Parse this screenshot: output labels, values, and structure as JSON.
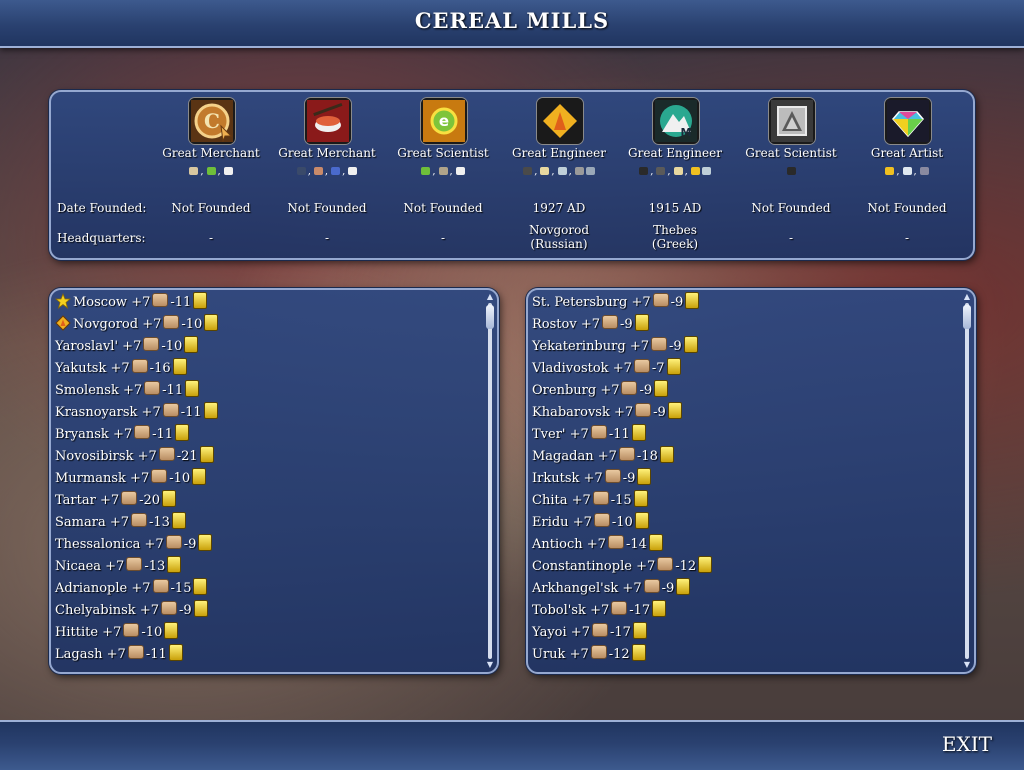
{
  "title": "CEREAL MILLS",
  "exit_label": "EXIT",
  "row_labels": {
    "date_founded": "Date Founded:",
    "headquarters": "Headquarters:"
  },
  "corporations": [
    {
      "icon": "cereal-mills-icon",
      "name": "Great Merchant",
      "resources": [
        {
          "c": "#d8c7a0",
          "sep": ","
        },
        {
          "c": "#6fbf3a",
          "sep": ","
        },
        {
          "c": "#f0f0f0",
          "sep": ""
        }
      ],
      "date": "Not Founded",
      "hq_line1": "-",
      "hq_line2": ""
    },
    {
      "icon": "sid-sushi-icon",
      "name": "Great Merchant",
      "resources": [
        {
          "c": "#3a4a6a",
          "sep": ","
        },
        {
          "c": "#c98a6a",
          "sep": ","
        },
        {
          "c": "#4a6acc",
          "sep": ","
        },
        {
          "c": "#f0f0f0",
          "sep": ""
        }
      ],
      "date": "Not Founded",
      "hq_line1": "-",
      "hq_line2": ""
    },
    {
      "icon": "standard-ethanol-icon",
      "name": "Great Scientist",
      "resources": [
        {
          "c": "#6fbf3a",
          "sep": ","
        },
        {
          "c": "#b0a48a",
          "sep": ","
        },
        {
          "c": "#f0f0f0",
          "sep": ""
        }
      ],
      "date": "Not Founded",
      "hq_line1": "-",
      "hq_line2": ""
    },
    {
      "icon": "creative-constructions-icon",
      "name": "Great Engineer",
      "resources": [
        {
          "c": "#4a4a4a",
          "sep": ","
        },
        {
          "c": "#e8d8a0",
          "sep": ","
        },
        {
          "c": "#bfcfd8",
          "sep": ","
        },
        {
          "c": "#9a9a9a",
          "sep": ""
        },
        {
          "c": "#9aa8b8",
          "sep": ""
        }
      ],
      "date": "1927 AD",
      "hq_line1": "Novgorod",
      "hq_line2": "(Russian)"
    },
    {
      "icon": "mining-inc-icon",
      "name": "Great Engineer",
      "resources": [
        {
          "c": "#2a2a2a",
          "sep": ","
        },
        {
          "c": "#5a5a5a",
          "sep": ","
        },
        {
          "c": "#e8d8a0",
          "sep": ","
        },
        {
          "c": "#f0c020",
          "sep": ""
        },
        {
          "c": "#bfcfd8",
          "sep": ""
        }
      ],
      "date": "1915 AD",
      "hq_line1": "Thebes",
      "hq_line2": "(Greek)"
    },
    {
      "icon": "aluminum-co-icon",
      "name": "Great Scientist",
      "resources": [
        {
          "c": "#2a2a2a",
          "sep": ""
        }
      ],
      "date": "Not Founded",
      "hq_line1": "-",
      "hq_line2": ""
    },
    {
      "icon": "civilized-jewelers-icon",
      "name": "Great Artist",
      "resources": [
        {
          "c": "#f0c020",
          "sep": ","
        },
        {
          "c": "#dfe8f0",
          "sep": ","
        },
        {
          "c": "#8a8aa0",
          "sep": ""
        }
      ],
      "date": "Not Founded",
      "hq_line1": "-",
      "hq_line2": ""
    }
  ],
  "cities_left": [
    {
      "name": "Moscow",
      "food": "+7",
      "gold": "-11",
      "flag": "capital-star-icon"
    },
    {
      "name": "Novgorod",
      "food": "+7",
      "gold": "-10",
      "flag": "headquarters-icon"
    },
    {
      "name": "Yaroslavl'",
      "food": "+7",
      "gold": "-10",
      "flag": ""
    },
    {
      "name": "Yakutsk",
      "food": "+7",
      "gold": "-16",
      "flag": ""
    },
    {
      "name": "Smolensk",
      "food": "+7",
      "gold": "-11",
      "flag": ""
    },
    {
      "name": "Krasnoyarsk",
      "food": "+7",
      "gold": "-11",
      "flag": ""
    },
    {
      "name": "Bryansk",
      "food": "+7",
      "gold": "-11",
      "flag": ""
    },
    {
      "name": "Novosibirsk",
      "food": "+7",
      "gold": "-21",
      "flag": ""
    },
    {
      "name": "Murmansk",
      "food": "+7",
      "gold": "-10",
      "flag": ""
    },
    {
      "name": "Tartar",
      "food": "+7",
      "gold": "-20",
      "flag": ""
    },
    {
      "name": "Samara",
      "food": "+7",
      "gold": "-13",
      "flag": ""
    },
    {
      "name": "Thessalonica",
      "food": "+7",
      "gold": "-9",
      "flag": ""
    },
    {
      "name": "Nicaea",
      "food": "+7",
      "gold": "-13",
      "flag": ""
    },
    {
      "name": "Adrianople",
      "food": "+7",
      "gold": "-15",
      "flag": ""
    },
    {
      "name": "Chelyabinsk",
      "food": "+7",
      "gold": "-9",
      "flag": ""
    },
    {
      "name": "Hittite",
      "food": "+7",
      "gold": "-10",
      "flag": ""
    },
    {
      "name": "Lagash",
      "food": "+7",
      "gold": "-11",
      "flag": ""
    }
  ],
  "cities_right": [
    {
      "name": "St. Petersburg",
      "food": "+7",
      "gold": "-9",
      "flag": ""
    },
    {
      "name": "Rostov",
      "food": "+7",
      "gold": "-9",
      "flag": ""
    },
    {
      "name": "Yekaterinburg",
      "food": "+7",
      "gold": "-9",
      "flag": ""
    },
    {
      "name": "Vladivostok",
      "food": "+7",
      "gold": "-7",
      "flag": ""
    },
    {
      "name": "Orenburg",
      "food": "+7",
      "gold": "-9",
      "flag": ""
    },
    {
      "name": "Khabarovsk",
      "food": "+7",
      "gold": "-9",
      "flag": ""
    },
    {
      "name": "Tver'",
      "food": "+7",
      "gold": "-11",
      "flag": ""
    },
    {
      "name": "Magadan",
      "food": "+7",
      "gold": "-18",
      "flag": ""
    },
    {
      "name": "Irkutsk",
      "food": "+7",
      "gold": "-9",
      "flag": ""
    },
    {
      "name": "Chita",
      "food": "+7",
      "gold": "-15",
      "flag": ""
    },
    {
      "name": "Eridu",
      "food": "+7",
      "gold": "-10",
      "flag": ""
    },
    {
      "name": "Antioch",
      "food": "+7",
      "gold": "-14",
      "flag": ""
    },
    {
      "name": "Constantinople",
      "food": "+7",
      "gold": "-12",
      "flag": ""
    },
    {
      "name": "Arkhangel'sk",
      "food": "+7",
      "gold": "-9",
      "flag": ""
    },
    {
      "name": "Tobol'sk",
      "food": "+7",
      "gold": "-17",
      "flag": ""
    },
    {
      "name": "Yayoi",
      "food": "+7",
      "gold": "-17",
      "flag": ""
    },
    {
      "name": "Uruk",
      "food": "+7",
      "gold": "-12",
      "flag": ""
    }
  ],
  "colors": {
    "panel_border": "#95a8d0",
    "panel_fill": "#2b4580",
    "food": "#d9b78a",
    "gold": "#f0d02a"
  }
}
